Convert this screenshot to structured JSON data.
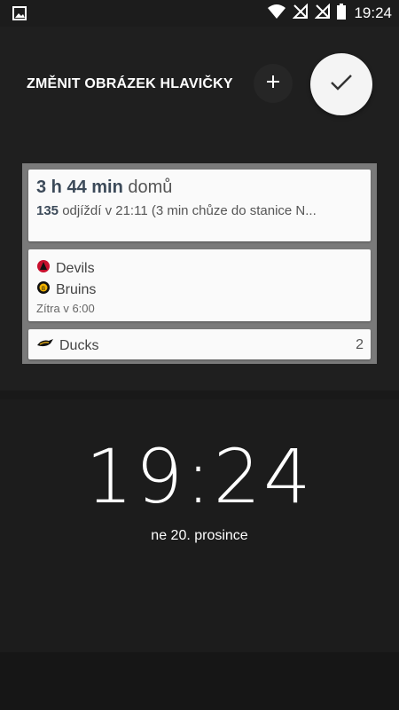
{
  "status_bar": {
    "time": "19:24",
    "icons": [
      "image-notification-icon",
      "wifi-icon",
      "signal-off-icon",
      "signal-off-icon",
      "battery-icon"
    ]
  },
  "header": {
    "title": "ZMĚNIT OBRÁZEK HLAVIČKY",
    "add_icon": "plus-icon",
    "confirm_icon": "check-icon"
  },
  "widget": {
    "commute": {
      "duration": "3 h 44 min",
      "destination": "domů",
      "line_number": "135",
      "departure_text": "odjíždí v 21:11 (3 min chůze do stanice N..."
    },
    "game": {
      "team_a": "Devils",
      "team_b": "Bruins",
      "time": "Zítra v 6:00"
    },
    "score": {
      "team": "Ducks",
      "count": "2"
    }
  },
  "lock": {
    "clock": "19:24",
    "date": "ne 20. prosince"
  },
  "colors": {
    "accent_dark": "#3c4a59",
    "frame": "#7a7a7a",
    "background": "#1f1f1f"
  }
}
